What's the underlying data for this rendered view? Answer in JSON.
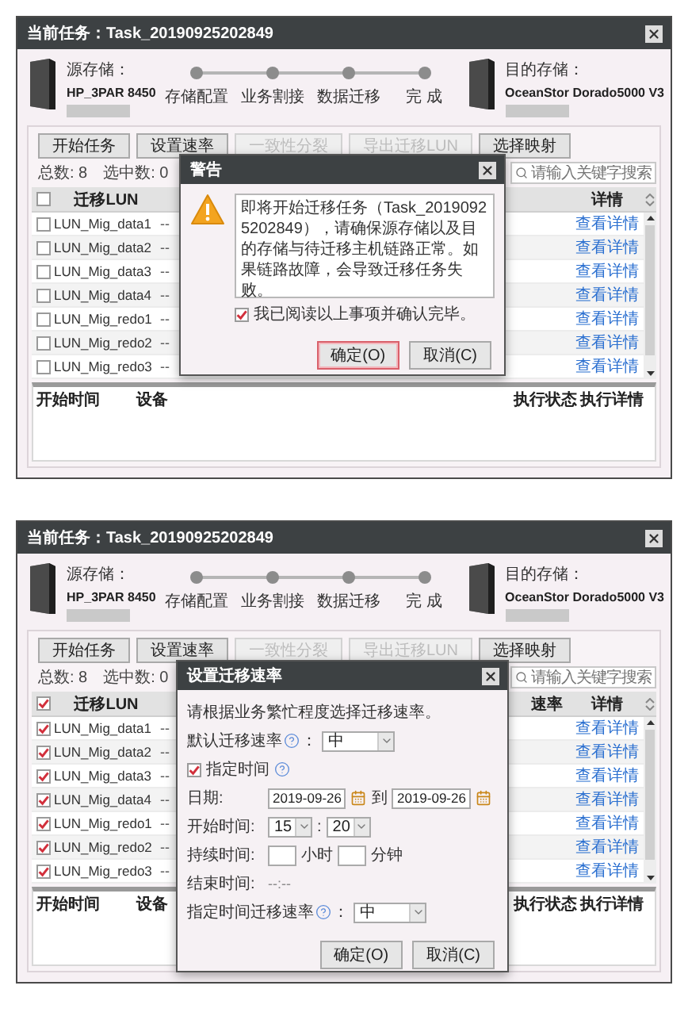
{
  "windows": [
    {
      "title": "当前任务：Task_20190925202849",
      "source": {
        "label": "源存储：",
        "name": "HP_3PAR 8450"
      },
      "steps": [
        {
          "label": "存储配置"
        },
        {
          "label": "业务割接"
        },
        {
          "label": "数据迁移"
        },
        {
          "label": "完 成"
        }
      ],
      "target": {
        "label": "目的存储：",
        "name": "OceanStor Dorado5000 V3"
      },
      "toolbar": [
        {
          "label": "开始任务",
          "disabled": false
        },
        {
          "label": "设置速率",
          "disabled": false
        },
        {
          "label": "一致性分裂",
          "disabled": true
        },
        {
          "label": "导出迁移LUN",
          "disabled": true
        },
        {
          "label": "选择映射",
          "disabled": false
        }
      ],
      "total": "总数: 8",
      "selected_count": "选中数: 0",
      "search": {
        "placeholder": "请输入关键字搜索"
      },
      "table": {
        "select_all_checked": false,
        "columns": [
          {
            "kind": "lun",
            "label": "迁移LUN"
          },
          {
            "kind": "detail",
            "label": "详情"
          }
        ],
        "rows": [
          {
            "checked": false,
            "lun": "LUN_Mig_data1",
            "column_3": "--",
            "detail": "查看详情"
          },
          {
            "checked": false,
            "lun": "LUN_Mig_data2",
            "column_3": "--",
            "detail": "查看详情"
          },
          {
            "checked": false,
            "lun": "LUN_Mig_data3",
            "column_3": "--",
            "detail": "查看详情"
          },
          {
            "checked": false,
            "lun": "LUN_Mig_data4",
            "column_3": "--",
            "detail": "查看详情"
          },
          {
            "checked": false,
            "lun": "LUN_Mig_redo1",
            "column_3": "--",
            "detail": "查看详情"
          },
          {
            "checked": false,
            "lun": "LUN_Mig_redo2",
            "column_3": "--",
            "detail": "查看详情"
          },
          {
            "checked": false,
            "lun": "LUN_Mig_redo3",
            "column_3": "--",
            "detail": "查看详情"
          }
        ]
      },
      "log_columns": [
        {
          "kind": "start",
          "label": "开始时间"
        },
        {
          "kind": "device",
          "label": "设备"
        },
        {
          "kind": "status",
          "label": "执行状态"
        },
        {
          "kind": "detail",
          "label": "执行详情"
        }
      ],
      "dialog": {
        "kind": "warning",
        "title": "警告",
        "message": "即将开始迁移任务（Task_20190925202849），请确保源存储以及目的存储与待迁移主机链路正常。如果链路故障，会导致迁移任务失败。",
        "confirm": {
          "label": "我已阅读以上事项并确认完毕。",
          "checked": true
        },
        "buttons": [
          {
            "label": "确定(O)",
            "focused": true
          },
          {
            "label": "取消(C)",
            "focused": false
          }
        ]
      }
    },
    {
      "title": "当前任务：Task_20190925202849",
      "source": {
        "label": "源存储：",
        "name": "HP_3PAR 8450"
      },
      "steps": [
        {
          "label": "存储配置"
        },
        {
          "label": "业务割接"
        },
        {
          "label": "数据迁移"
        },
        {
          "label": "完 成"
        }
      ],
      "target": {
        "label": "目的存储：",
        "name": "OceanStor Dorado5000 V3"
      },
      "toolbar": [
        {
          "label": "开始任务",
          "disabled": false
        },
        {
          "label": "设置速率",
          "disabled": false
        },
        {
          "label": "一致性分裂",
          "disabled": true
        },
        {
          "label": "导出迁移LUN",
          "disabled": true
        },
        {
          "label": "选择映射",
          "disabled": false
        }
      ],
      "total": "总数: 8",
      "selected_count": "选中数: 0",
      "search": {
        "placeholder": "请输入关键字搜索"
      },
      "table": {
        "select_all_checked": true,
        "columns": [
          {
            "kind": "lun",
            "label": "迁移LUN"
          },
          {
            "kind": "rate",
            "label": "速率"
          },
          {
            "kind": "detail",
            "label": "详情"
          }
        ],
        "rows": [
          {
            "checked": true,
            "lun": "LUN_Mig_data1",
            "column_3": "--",
            "detail": "查看详情"
          },
          {
            "checked": true,
            "lun": "LUN_Mig_data2",
            "column_3": "--",
            "detail": "查看详情"
          },
          {
            "checked": true,
            "lun": "LUN_Mig_data3",
            "column_3": "--",
            "detail": "查看详情"
          },
          {
            "checked": true,
            "lun": "LUN_Mig_data4",
            "column_3": "--",
            "detail": "查看详情"
          },
          {
            "checked": true,
            "lun": "LUN_Mig_redo1",
            "column_3": "--",
            "detail": "查看详情"
          },
          {
            "checked": true,
            "lun": "LUN_Mig_redo2",
            "column_3": "--",
            "detail": "查看详情"
          },
          {
            "checked": true,
            "lun": "LUN_Mig_redo3",
            "column_3": "--",
            "detail": "查看详情"
          }
        ]
      },
      "log_columns": [
        {
          "kind": "start",
          "label": "开始时间"
        },
        {
          "kind": "device",
          "label": "设备"
        },
        {
          "kind": "status",
          "label": "执行状态"
        },
        {
          "kind": "detail",
          "label": "执行详情"
        }
      ],
      "dialog": {
        "kind": "rate",
        "title": "设置迁移速率",
        "intro": "请根据业务繁忙程度选择迁移速率。",
        "default_rate": {
          "label": "默认迁移速率",
          "suffix": "：",
          "value": "中"
        },
        "specify_time": {
          "label": "指定时间",
          "checked": true
        },
        "date": {
          "label": "日期:",
          "from": "2019-09-26",
          "to_word": "到",
          "to": "2019-09-26"
        },
        "start_time": {
          "label": "开始时间:",
          "hour": "15",
          "separator": ":",
          "minute": "20"
        },
        "duration": {
          "label": "持续时间:",
          "hours_unit": "小时",
          "minutes_unit": "分钟"
        },
        "end_time": {
          "label": "结束时间:",
          "value": "--:--"
        },
        "specified_rate": {
          "label": "指定时间迁移速率",
          "suffix": "：",
          "value": "中"
        },
        "buttons": [
          {
            "label": "确定(O)",
            "focused": false
          },
          {
            "label": "取消(C)",
            "focused": false
          }
        ]
      }
    }
  ]
}
